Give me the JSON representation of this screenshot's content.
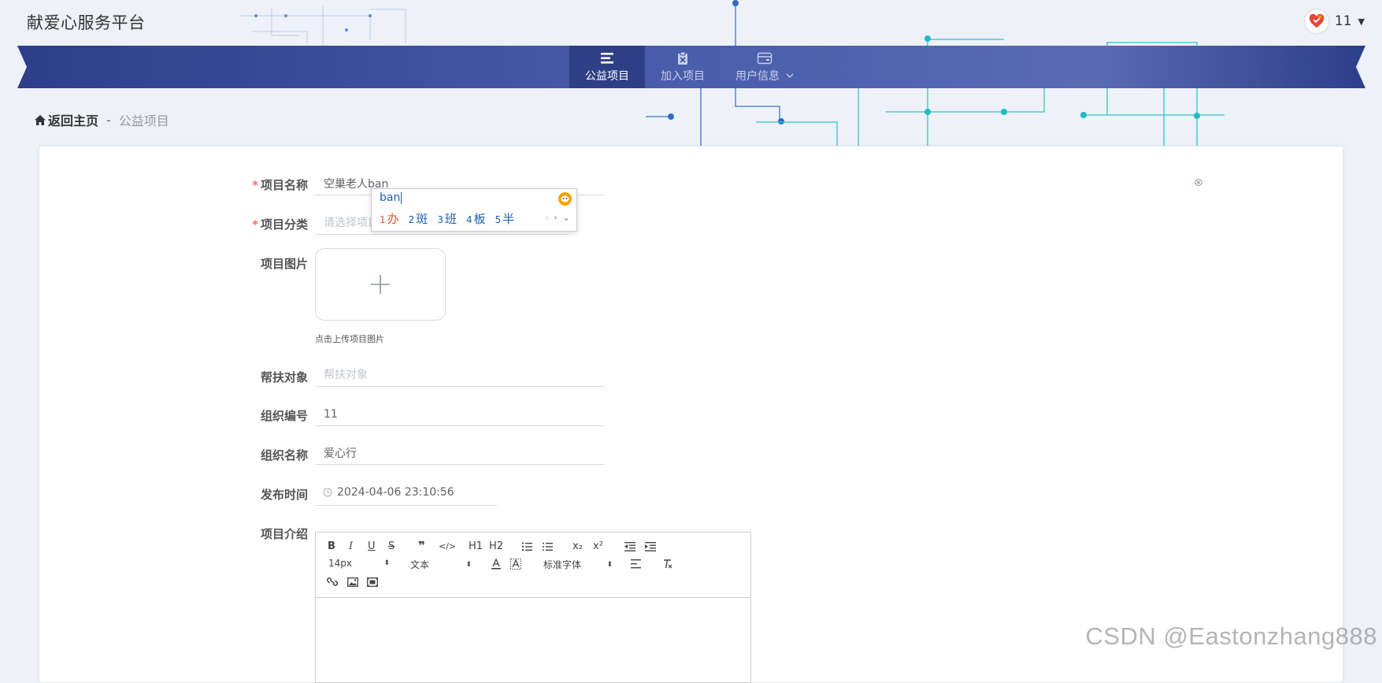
{
  "header": {
    "site_title": "献爱心服务平台",
    "user_name": "11"
  },
  "nav": {
    "items": [
      {
        "label": "公益项目",
        "icon": "list-icon",
        "active": true
      },
      {
        "label": "加入项目",
        "icon": "clipboard-x-icon",
        "active": false
      },
      {
        "label": "用户信息",
        "icon": "wallet-icon",
        "active": false
      }
    ]
  },
  "breadcrumb": {
    "home": "返回主页",
    "separator": "-",
    "current": "公益项目"
  },
  "form": {
    "name": {
      "label": "项目名称",
      "value": "空巢老人ban",
      "required": true
    },
    "category": {
      "label": "项目分类",
      "placeholder": "请选择项目",
      "required": true
    },
    "image": {
      "label": "项目图片",
      "tip": "点击上传项目图片"
    },
    "target": {
      "label": "帮扶对象",
      "placeholder": "帮扶对象"
    },
    "org_id": {
      "label": "组织编号",
      "value": "11"
    },
    "org_name": {
      "label": "组织名称",
      "value": "爱心行"
    },
    "publish_time": {
      "label": "发布时间",
      "value": "2024-04-06 23:10:56"
    },
    "intro": {
      "label": "项目介绍"
    }
  },
  "ime": {
    "composition": "ban",
    "candidates": [
      {
        "num": "1",
        "char": "办"
      },
      {
        "num": "2",
        "char": "斑"
      },
      {
        "num": "3",
        "char": "班"
      },
      {
        "num": "4",
        "char": "板"
      },
      {
        "num": "5",
        "char": "半"
      }
    ]
  },
  "editor": {
    "font_size": "14px",
    "block_format": "文本",
    "font_family": "标准字体",
    "buttons": {
      "bold": "B",
      "italic": "I",
      "underline": "U",
      "strike": "S",
      "quote": "❞",
      "code": "</>",
      "h1": "H1",
      "h2": "H2",
      "sub": "x₂",
      "sup": "x²"
    }
  },
  "watermark": "CSDN @Eastonzhang888",
  "colors": {
    "nav_bg": "#3d4f9c",
    "nav_active": "#2f3f86",
    "required": "#f56c6c",
    "accent_cyan": "#22c6d8"
  }
}
